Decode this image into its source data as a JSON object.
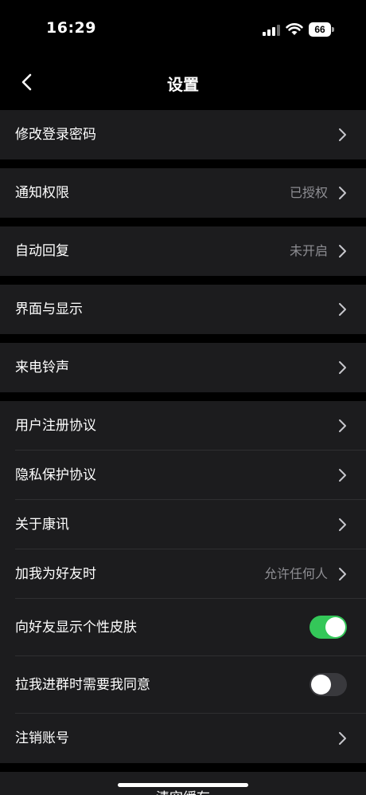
{
  "status_bar": {
    "time": "16:29",
    "battery": "66"
  },
  "nav": {
    "title": "设置",
    "back_icon": "chevron-left-icon"
  },
  "groups": [
    {
      "rows": [
        {
          "label": "修改登录密码"
        }
      ]
    },
    {
      "rows": [
        {
          "label": "通知权限",
          "value": "已授权"
        }
      ]
    },
    {
      "rows": [
        {
          "label": "自动回复",
          "value": "未开启"
        }
      ]
    },
    {
      "rows": [
        {
          "label": "界面与显示"
        }
      ]
    },
    {
      "rows": [
        {
          "label": "来电铃声"
        }
      ]
    },
    {
      "rows": [
        {
          "label": "用户注册协议"
        },
        {
          "label": "隐私保护协议"
        },
        {
          "label": "关于康讯"
        },
        {
          "label": "加我为好友时",
          "value": "允许任何人"
        },
        {
          "label": "向好友显示个性皮肤",
          "toggle": true
        },
        {
          "label": "拉我进群时需要我同意",
          "toggle": false
        },
        {
          "label": "注销账号"
        }
      ]
    }
  ],
  "bottom": {
    "clear_cache": "清空缓存"
  },
  "colors": {
    "toggle_on": "#34c759",
    "toggle_off": "#39393d",
    "cell_bg": "#1c1c1e",
    "secondary_text": "#8e8e93"
  }
}
